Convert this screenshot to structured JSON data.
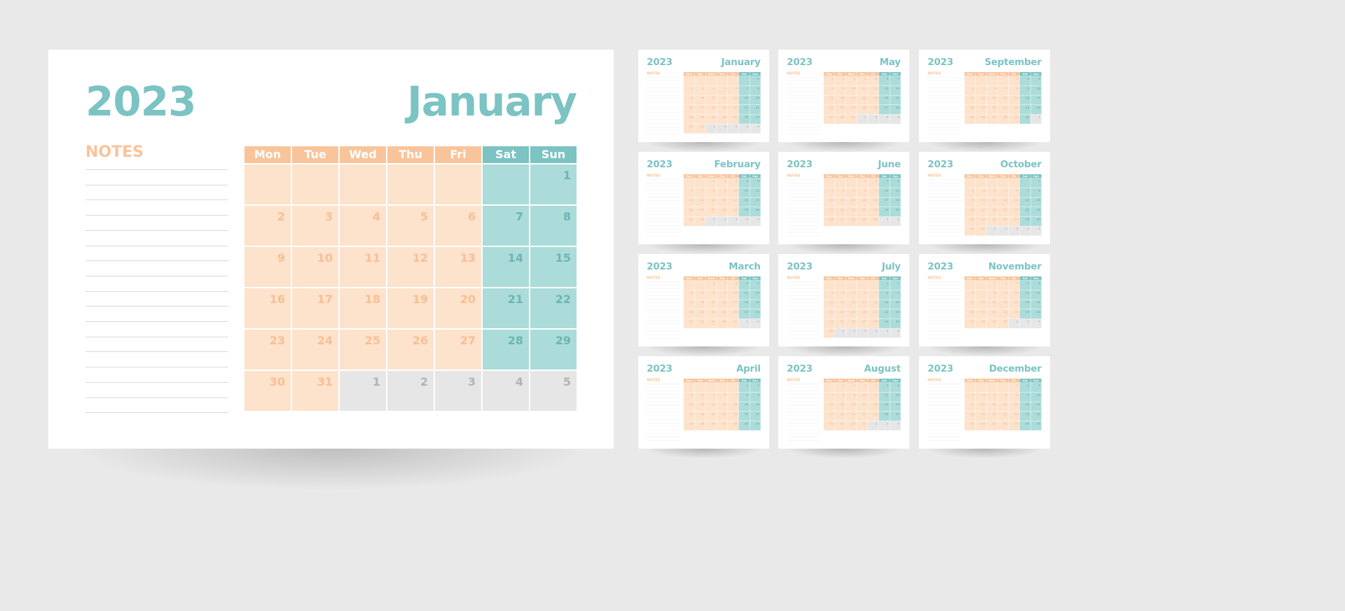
{
  "year": "2023",
  "notes_label": "NOTES",
  "weekdays": [
    "Mon",
    "Tue",
    "Wed",
    "Thu",
    "Fri",
    "Sat",
    "Sun"
  ],
  "colors": {
    "background": "#e9e9e9",
    "teal": "#7cc3c3",
    "teal_light": "#abdcd9",
    "orange": "#f9c49a",
    "orange_light": "#fde2cc",
    "gray": "#e6e6e6"
  },
  "main": {
    "month_index": 0
  },
  "months": [
    {
      "name": "January",
      "first_weekday": 6,
      "days": 31
    },
    {
      "name": "February",
      "first_weekday": 2,
      "days": 28
    },
    {
      "name": "March",
      "first_weekday": 2,
      "days": 31
    },
    {
      "name": "April",
      "first_weekday": 5,
      "days": 30
    },
    {
      "name": "May",
      "first_weekday": 0,
      "days": 31
    },
    {
      "name": "June",
      "first_weekday": 3,
      "days": 30
    },
    {
      "name": "July",
      "first_weekday": 5,
      "days": 31
    },
    {
      "name": "August",
      "first_weekday": 1,
      "days": 31
    },
    {
      "name": "September",
      "first_weekday": 4,
      "days": 30
    },
    {
      "name": "October",
      "first_weekday": 6,
      "days": 31
    },
    {
      "name": "November",
      "first_weekday": 2,
      "days": 30
    },
    {
      "name": "December",
      "first_weekday": 4,
      "days": 31
    }
  ]
}
